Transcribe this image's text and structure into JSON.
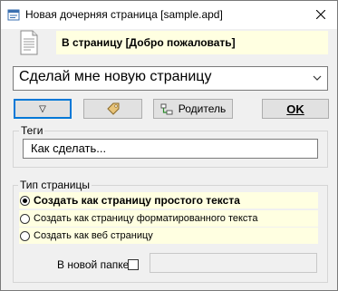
{
  "window": {
    "title": "Новая дочерняя страница [sample.apd]",
    "app_icon": "app-icon",
    "close_icon": "close-icon"
  },
  "header": {
    "doc_icon": "document-icon",
    "target_text": "В страницу [Добро пожаловать]"
  },
  "page_name": {
    "value": "Сделай мне новую страницу",
    "arrow_icon": "chevron-down-icon"
  },
  "toolbar": {
    "arrow_button_glyph": "▽",
    "tag_icon": "tag-icon",
    "parent_icon": "parent-icon",
    "parent_label": "Родитель",
    "ok_label": "OK"
  },
  "tags": {
    "group_label": "Теги",
    "value": "Как сделать..."
  },
  "page_type": {
    "group_label": "Тип страницы",
    "options": [
      {
        "label": "Создать как страницу простого текста",
        "selected": true
      },
      {
        "label": "Создать как страницу форматированного текста",
        "selected": false
      },
      {
        "label": "Создать как веб страницу",
        "selected": false
      }
    ]
  },
  "folder": {
    "label": "В новой папке",
    "checked": false,
    "value": ""
  },
  "colors": {
    "highlight": "#ffffe1",
    "focus": "#0078d7",
    "background": "#f0f0f0"
  }
}
